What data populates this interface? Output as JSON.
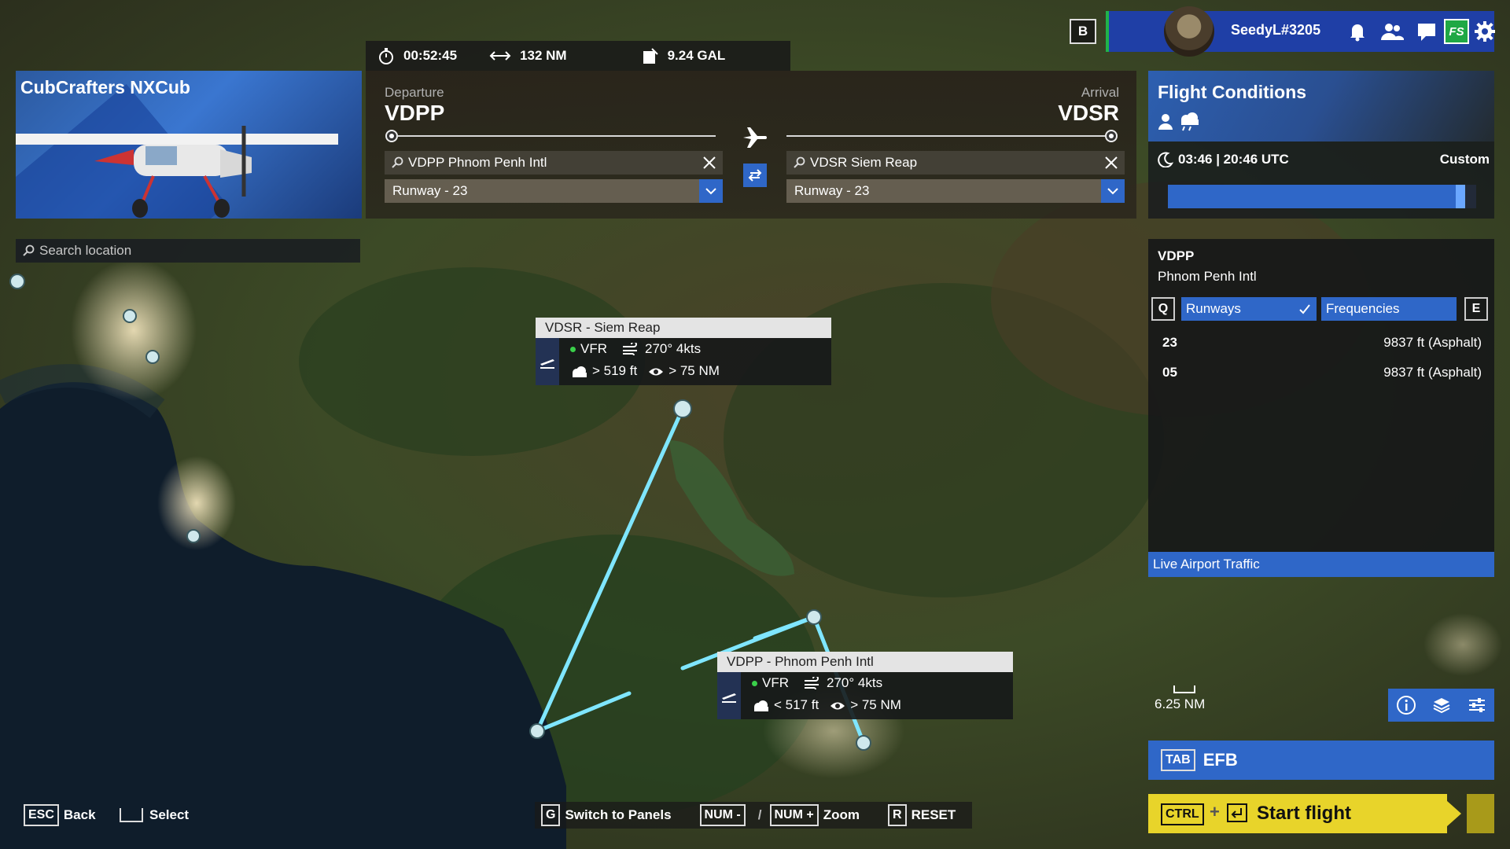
{
  "stats": {
    "time": "00:52:45",
    "distance": "132 NM",
    "fuel": "9.24 GAL"
  },
  "user": {
    "b_key": "B",
    "name": "SeedyL#3205",
    "fs_label": "FS"
  },
  "aircraft": {
    "name": "CubCrafters NXCub"
  },
  "search": {
    "placeholder": "Search location"
  },
  "departure": {
    "label": "Departure",
    "code": "VDPP",
    "airport_field": "VDPP Phnom Penh Intl",
    "runway": "Runway - 23"
  },
  "arrival": {
    "label": "Arrival",
    "code": "VDSR",
    "airport_field": "VDSR Siem Reap",
    "runway": "Runway - 23"
  },
  "conditions": {
    "title": "Flight Conditions",
    "time": "03:46 | 20:46 UTC",
    "mode": "Custom",
    "slider_fraction": 0.95
  },
  "airport_info": {
    "code": "VDPP",
    "name": "Phnom Penh Intl",
    "key_left": "Q",
    "key_right": "E",
    "tab_runways": "Runways",
    "tab_frequencies": "Frequencies",
    "runways": [
      {
        "id": "23",
        "info": "9837 ft (Asphalt)"
      },
      {
        "id": "05",
        "info": "9837 ft (Asphalt)"
      }
    ],
    "live_traffic": "Live Airport Traffic"
  },
  "map_labels": {
    "arrival_box": {
      "title": "VDSR - Siem Reap",
      "rules": "VFR",
      "wind": "270° 4kts",
      "ceiling": "> 519 ft",
      "visibility": "> 75 NM"
    },
    "departure_box": {
      "title": "VDPP - Phnom Penh Intl",
      "rules": "VFR",
      "wind": "270° 4kts",
      "ceiling": "< 517 ft",
      "visibility": "> 75 NM"
    }
  },
  "scale": "6.25 NM",
  "efb": {
    "key": "TAB",
    "label": "EFB"
  },
  "start_flight": {
    "key": "CTRL",
    "label": "Start flight"
  },
  "hints": {
    "back_key": "ESC",
    "back": "Back",
    "select": "Select",
    "panels_key": "G",
    "panels": "Switch to Panels",
    "zoom_out_key": "NUM -",
    "zoom_sep": "/",
    "zoom_in_key": "NUM +",
    "zoom": "Zoom",
    "reset_key": "R",
    "reset": "RESET"
  },
  "colors": {
    "accent": "#2f67c8",
    "start": "#e8d42a",
    "route": "#7fe6ff",
    "vfr": "#3ad04a"
  }
}
